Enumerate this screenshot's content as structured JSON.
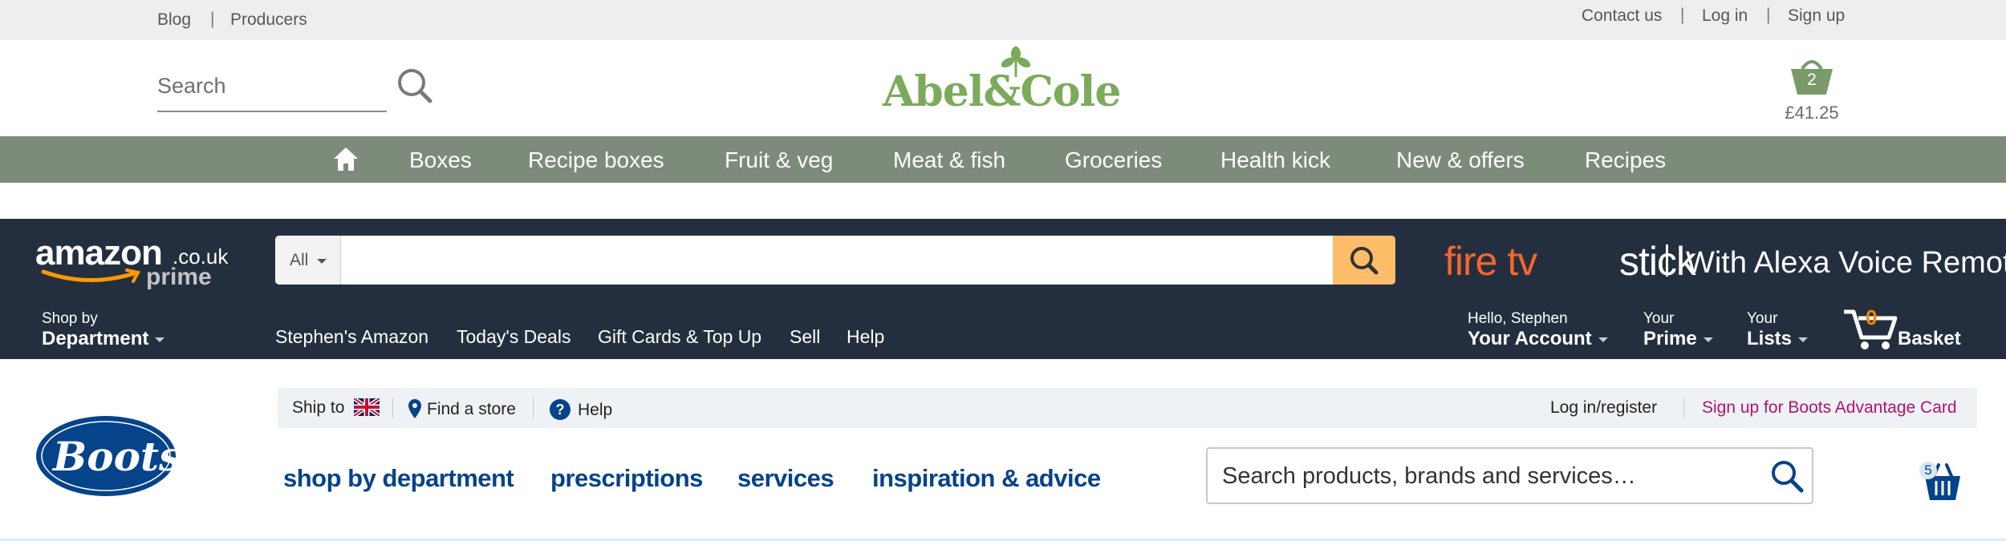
{
  "abel_cole": {
    "top_left_links": [
      "Blog",
      "Producers"
    ],
    "top_right_links": [
      "Contact us",
      "Log in",
      "Sign up"
    ],
    "search_placeholder": "Search",
    "logo_text": "Abel&Cole",
    "basket_count": "2",
    "basket_total": "£41.25",
    "nav_items": [
      "Boxes",
      "Recipe boxes",
      "Fruit & veg",
      "Meat & fish",
      "Groceries",
      "Health kick",
      "New & offers",
      "Recipes"
    ],
    "colors": {
      "nav_bg": "#7d8c7a",
      "logo_green": "#7bab5a",
      "basket_green": "#7a9a6a"
    }
  },
  "amazon": {
    "logo": {
      "main": "amazon",
      "domain": ".co.uk",
      "prime": "prime"
    },
    "search_category": "All",
    "promo": {
      "fire": "fire tv",
      "stick": "stick",
      "tagline": "With Alexa Voice Remote"
    },
    "shop_by": {
      "line1": "Shop by",
      "line2": "Department"
    },
    "nav_links": [
      "Stephen's Amazon",
      "Today's Deals",
      "Gift Cards & Top Up",
      "Sell",
      "Help"
    ],
    "account": {
      "line1": "Hello, Stephen",
      "line2": "Your Account"
    },
    "prime": {
      "line1": "Your",
      "line2": "Prime"
    },
    "lists": {
      "line1": "Your",
      "line2": "Lists"
    },
    "basket": {
      "count": "0",
      "label": "Basket"
    },
    "colors": {
      "bg": "#232f3e",
      "search_button": "#febd69",
      "fire_orange": "#f5662b",
      "cart_count": "#f08804"
    }
  },
  "boots": {
    "logo_text": "Boots",
    "utility": {
      "ship_to": "Ship to",
      "find_store": "Find a store",
      "help": "Help",
      "login": "Log in/register",
      "advantage": "Sign up for Boots Advantage Card"
    },
    "nav_items": [
      "shop by department",
      "prescriptions",
      "services",
      "inspiration & advice"
    ],
    "search_placeholder": "Search products, brands and services…",
    "basket_count": "5",
    "colors": {
      "brand_blue": "#05438a",
      "advantage_pink": "#b4126e",
      "utility_bg": "#eff2f5"
    }
  }
}
